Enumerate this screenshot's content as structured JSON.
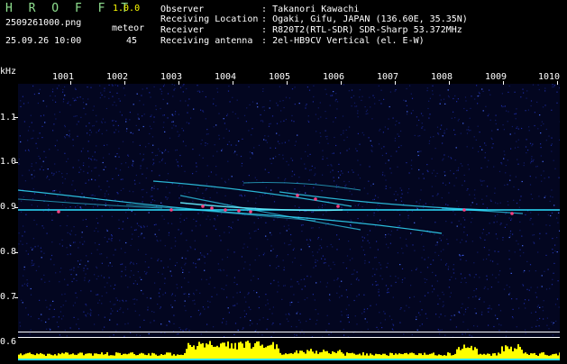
{
  "header": {
    "app_title": "H R O F F T",
    "version": "1.0.0",
    "filename": "2509261000.png",
    "datetime": "25.09.26 10:00",
    "meteor_label": "meteor",
    "meteor_count": "45"
  },
  "info": [
    {
      "key": "Observer",
      "sep": ":",
      "value": "Takanori Kawachi"
    },
    {
      "key": "Receiving Location",
      "sep": ":",
      "value": "Ogaki, Gifu, JAPAN (136.60E, 35.35N)"
    },
    {
      "key": "Receiver",
      "sep": ":",
      "value": "R820T2(RTL-SDR) SDR-Sharp 53.372MHz"
    },
    {
      "key": "Receiving antenna",
      "sep": ":",
      "value": "2el-HB9CV Vertical (el. E-W)"
    }
  ],
  "axes": {
    "y_unit": "kHz",
    "x_ticks": [
      "1001",
      "1002",
      "1003",
      "1004",
      "1005",
      "1006",
      "1007",
      "1008",
      "1009",
      "1010"
    ],
    "y_ticks": [
      "1.1",
      "1.0",
      "0.9",
      "0.8",
      "0.7",
      "0.6"
    ]
  },
  "colors": {
    "background": "#000000",
    "plot_bg": "#030620",
    "noise": "#1c2a9c",
    "trace": "#33e0ff",
    "hot": "#ff4080",
    "reference_line": "#2de0ff",
    "amplitude": "#ffff00",
    "title": "#8fe08f"
  }
}
